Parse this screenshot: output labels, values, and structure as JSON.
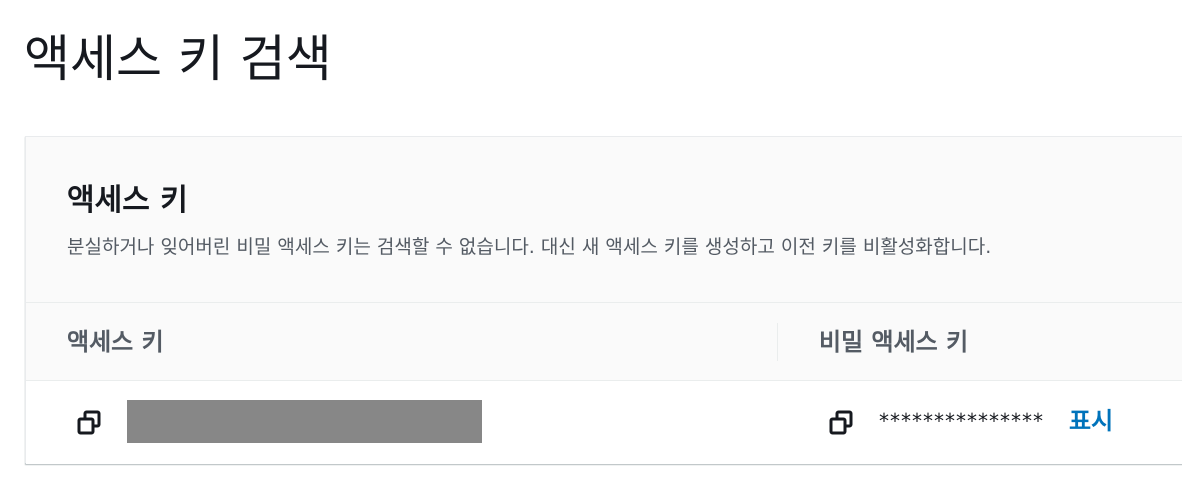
{
  "page": {
    "title": "액세스 키 검색"
  },
  "panel": {
    "title": "액세스 키",
    "description": "분실하거나 잊어버린 비밀 액세스 키는 검색할 수 없습니다. 대신 새 액세스 키를 생성하고 이전 키를 비활성화합니다."
  },
  "table": {
    "columns": [
      "액세스 키",
      "비밀 액세스 키"
    ],
    "row": {
      "access_key": "",
      "secret_mask": "***************",
      "show_label": "표시"
    }
  },
  "icons": {
    "copy": "copy-icon"
  },
  "colors": {
    "link": "#0073bb",
    "redaction": "#878787",
    "header_bg": "#fafafa"
  }
}
